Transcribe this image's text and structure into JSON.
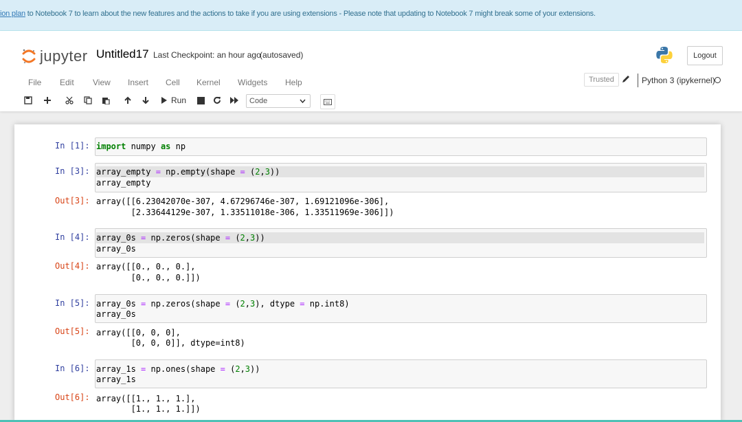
{
  "banner": {
    "link_text": "ion plan",
    "message": " to Notebook 7 to learn about the new features and the actions to take if you are using extensions - Please note that updating to Notebook 7 might break some of your extensions."
  },
  "header": {
    "logo_text": "jupyter",
    "notebook_title": "Untitled17",
    "checkpoint": "Last Checkpoint: an hour ago",
    "autosave": "(autosaved)",
    "logout": "Logout"
  },
  "menubar": {
    "items": [
      "File",
      "Edit",
      "View",
      "Insert",
      "Cell",
      "Kernel",
      "Widgets",
      "Help"
    ],
    "trusted": "Trusted",
    "kernel": "Python 3 (ipykernel)"
  },
  "toolbar": {
    "run_label": "Run",
    "cell_type": "Code"
  },
  "cells": {
    "c1": {
      "prompt": "In [1]:",
      "code": [
        "import numpy as np"
      ]
    },
    "c2": {
      "prompt": "In [3]:",
      "code": [
        "array_empty = np.empty(shape = (2,3))",
        "array_empty"
      ],
      "out_prompt": "Out[3]:",
      "output": [
        "array([[6.23042070e-307, 4.67296746e-307, 1.69121096e-306],",
        "       [2.33644129e-307, 1.33511018e-306, 1.33511969e-306]])"
      ]
    },
    "c3": {
      "prompt": "In [4]:",
      "code": [
        "array_0s = np.zeros(shape = (2,3))",
        "array_0s"
      ],
      "out_prompt": "Out[4]:",
      "output": [
        "array([[0., 0., 0.],",
        "       [0., 0., 0.]])"
      ]
    },
    "c4": {
      "prompt": "In [5]:",
      "code": [
        "array_0s = np.zeros(shape = (2,3), dtype = np.int8)",
        "array_0s"
      ],
      "out_prompt": "Out[5]:",
      "output": [
        "array([[0, 0, 0],",
        "       [0, 0, 0]], dtype=int8)"
      ]
    },
    "c5": {
      "prompt": "In [6]:",
      "code": [
        "array_1s = np.ones(shape = (2,3))",
        "array_1s"
      ],
      "out_prompt": "Out[6]:",
      "output": [
        "array([[1., 1., 1.],",
        "       [1., 1., 1.]])"
      ]
    }
  },
  "colors": {
    "banner_bg": "#d9edf7",
    "in_prompt": "#303f9f",
    "out_prompt": "#d84315",
    "keyword": "#008000",
    "operator": "#aa22ff",
    "logo_orange": "#f37726"
  }
}
